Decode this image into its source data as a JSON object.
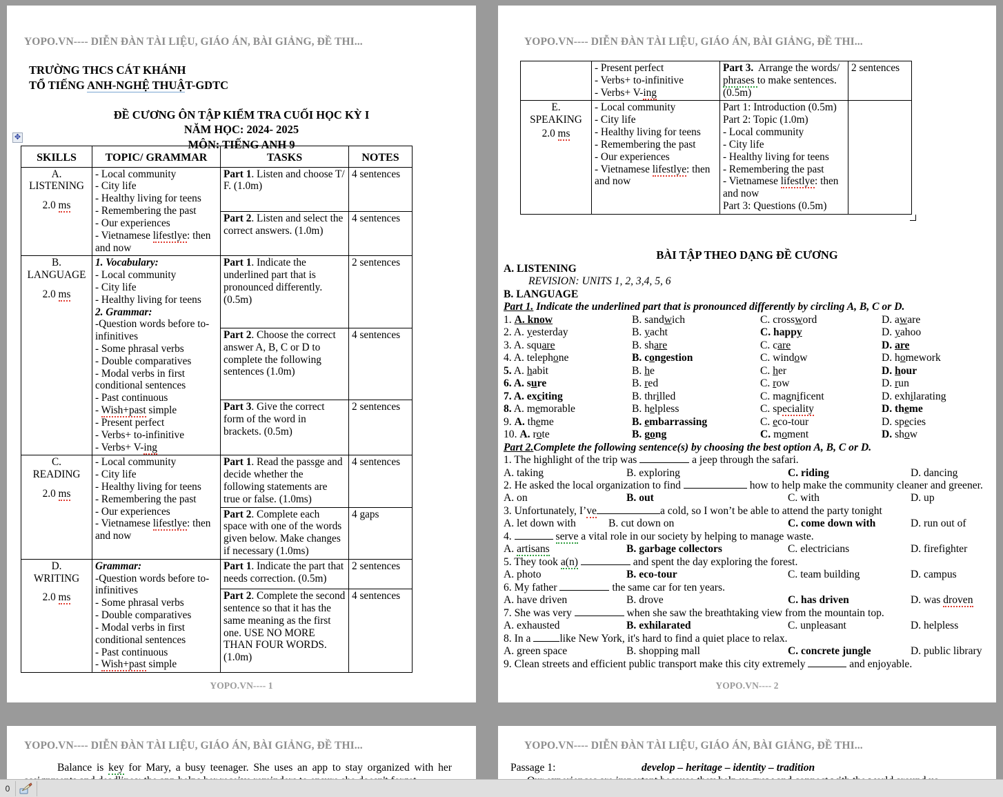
{
  "watermark": {
    "header": "YOPO.VN---- DIỄN ĐÀN TÀI LIỆU, GIÁO ÁN, BÀI GIẢNG, ĐỀ THI...",
    "footer_page1": "YOPO.VN---- 1",
    "footer_page2": "YOPO.VN---- 2"
  },
  "school": {
    "line1": "TRƯỜNG THCS CÁT KHÁNH",
    "line2_a": "TỔ TIẾNG ",
    "line2_b": "ANH-NGHỆ THUẬ",
    "line2_c": "T-GDTC"
  },
  "title": {
    "line1": "ĐỀ CƯƠNG ÔN TẬP KIỂM TRA CUỐI HỌC KỲ I",
    "line2": "NĂM HỌC: 2024- 2025",
    "line3": "MÔN: TIẾNG ANH 9"
  },
  "outline_table": {
    "headers": [
      "SKILLS",
      "TOPIC/ GRAMMAR",
      "TASKS",
      "NOTES"
    ],
    "listening": {
      "skill": "A.\nLISTENING",
      "skill_line1": "A.",
      "skill_line2": "LISTENING",
      "marks": "2.0 ms",
      "topics": [
        "- Local community",
        "- City life",
        "- Healthy living for teens",
        "- Remembering the past",
        "- Our experiences",
        "- Vietnamese lifestlye: then and now"
      ],
      "tasks": [
        {
          "label": "Part 1",
          "text": ". Listen and choose T/ F.  (1.0m)",
          "notes": "4 sentences"
        },
        {
          "label": "Part 2",
          "text": ". Listen and select the correct answers. (1.0m)",
          "notes": "4 sentences"
        }
      ]
    },
    "language": {
      "skill_line1": "B.",
      "skill_line2": "LANGUAGE",
      "marks": "2.0 ms",
      "vocab_heading": "1. Vocabulary:",
      "vocab_items": [
        "- Local community",
        "- City life",
        "- Healthy living for teens"
      ],
      "grammar_heading": "2. Grammar:",
      "grammar_items": [
        "-Question words before to-infinitives",
        "- Some phrasal verbs",
        "-  Double comparatives",
        "- Modal verbs in first conditional sentences",
        "- Past continuous",
        "- Wish+past simple",
        "- Present perfect",
        "- Verbs+ to-infinitive",
        "- Verbs+ V-ing"
      ],
      "tasks": [
        {
          "label": "Part 1",
          "text": ". Indicate the underlined part that is pronounced differently. (0.5m)",
          "notes": "2 sentences"
        },
        {
          "label": "Part 2",
          "text": ".  Choose the correct answer A, B, C or D to complete the following sentences (1.0m)",
          "notes": "4 sentences"
        },
        {
          "label": "Part 3",
          "text": ". Give the correct form of the word in brackets.  (0.5m)",
          "notes": "2 sentences"
        }
      ]
    },
    "reading": {
      "skill_line1": "C.",
      "skill_line2": "READING",
      "marks": "2.0 ms",
      "topics": [
        "- Local community",
        "- City life",
        "- Healthy living for teens",
        "- Remembering the past",
        "- Our experiences",
        "- Vietnamese lifestlye: then and now"
      ],
      "tasks": [
        {
          "label": "Part 1",
          "text": ". Read the passge and decide whether the following statements are true or false.  (1.0ms)",
          "notes": "4 sentences"
        },
        {
          "label": "Part 2",
          "text": ".  Complete each space with one of the words given below. Make changes if necessary (1.0ms)",
          "notes": "4 gaps"
        }
      ]
    },
    "writing": {
      "skill_line1": "D.",
      "skill_line2": "WRITING",
      "marks": "2.0 ms",
      "grammar_heading": "Grammar:",
      "grammar_items": [
        "-Question words before to-infinitives",
        "- Some phrasal verbs",
        "-  Double comparatives",
        "- Modal verbs in first conditional sentences",
        "- Past continuous",
        "- Wish+past simple"
      ],
      "tasks": [
        {
          "label": "Part 1",
          "text": ". Indicate the part that needs correction. (0.5m)",
          "notes": "2 sentences"
        },
        {
          "label": "Part 2",
          "text": ".  Complete the second sentence so that it has the same meaning as the first one. USE NO MORE THAN FOUR WORDS.  (1.0m)",
          "notes": "4 sentences"
        }
      ]
    },
    "continued": {
      "grammar_items": [
        "- Present perfect",
        "- Verbs+ to-infinitive",
        "- Verbs+ V-ing"
      ],
      "task_label": "Part 3.",
      "task_text": "  Arrange the words/ phrases  to make sentences. (0.5m)",
      "notes": "2 sentences"
    },
    "speaking": {
      "skill_line1": "E.",
      "skill_line2": "SPEAKING",
      "marks": "2.0 ms",
      "topics": [
        "- Local community",
        "- City life",
        "- Healthy living for teens",
        "- Remembering the past",
        "- Our experiences",
        "- Vietnamese lifestlye: then and now"
      ],
      "tasks": [
        "Part 1: Introduction (0.5m)",
        "Part 2: Topic (1.0m)",
        "- Local community",
        "- City life",
        "- Healthy living for teens",
        "- Remembering the past",
        "- Our experiences",
        "- Vietnamese lifestlye: then and now",
        "Part 3: Questions (0.5m)"
      ],
      "notes": ""
    }
  },
  "exercises": {
    "title": "BÀI TẬP THEO DẠNG ĐỀ CƯƠNG",
    "section_a": "A. LISTENING",
    "revision": "REVISION: UNITS 1, 2, 3,4, 5, 6",
    "section_b": "B. LANGUAGE",
    "part1_heading_a": "Part 1.",
    "part1_heading_b": " Indicate the underlined part that is pronounced differently by circling A, B, C or D.",
    "part1_items": [
      {
        "n": "1.",
        "n_bold": false,
        "a": "A. know",
        "a_bold": true,
        "b": "B. sandwich",
        "b_bold": false,
        "c": "C. crossword",
        "c_bold": false,
        "d": "D. aware",
        "d_bold": false
      },
      {
        "n": "2.",
        "n_bold": false,
        "a": "A. yesterday",
        "a_bold": false,
        "b": "B. yacht",
        "b_bold": false,
        "c": "C. happy",
        "c_bold": true,
        "d": "D. yahoo",
        "d_bold": false
      },
      {
        "n": "3.",
        "n_bold": false,
        "a": "A. square",
        "a_bold": false,
        "b": "B. share",
        "b_bold": false,
        "c": "C. care",
        "c_bold": false,
        "d": "D. are",
        "d_bold": true
      },
      {
        "n": "4.",
        "n_bold": false,
        "a": "A. telephone",
        "a_bold": false,
        "b": "B. congestion",
        "b_bold": true,
        "c": "C. window",
        "c_bold": false,
        "d": "D. homework",
        "d_bold": false
      },
      {
        "n": "5.",
        "n_bold": true,
        "a": "A. habit",
        "a_bold": false,
        "b": "B. he",
        "b_bold": false,
        "c": "C. her",
        "c_bold": false,
        "d": "D. hour",
        "d_bold": true
      },
      {
        "n": "6.",
        "n_bold": true,
        "a": "A. sure",
        "a_bold": true,
        "b": "B. red",
        "b_bold": false,
        "c": "C. row",
        "c_bold": false,
        "d": "D. run",
        "d_bold": false
      },
      {
        "n": "7.",
        "n_bold": true,
        "a": "A. exciting",
        "a_bold": true,
        "b": "B. thrilled",
        "b_bold": false,
        "c": "C. magnificent",
        "c_bold": false,
        "d": "D. exhilarating",
        "d_bold": false
      },
      {
        "n": "8.",
        "n_bold": true,
        "a": "A. memorable",
        "a_bold": false,
        "b": "B. helpless",
        "b_bold": false,
        "c": "C. speciality",
        "c_bold": false,
        "d": "D. theme",
        "d_bold": true
      },
      {
        "n": "9.",
        "n_bold": false,
        "a": "A. theme",
        "a_bold": true,
        "b": "B. embarrassing",
        "b_bold": true,
        "c": "C. eco-tour",
        "c_bold": false,
        "d": "D. species",
        "d_bold": false
      },
      {
        "n": "10.",
        "n_bold": false,
        "a": "A. rote",
        "a_bold": true,
        "b": "B. gong",
        "b_bold": true,
        "c": "C. moment",
        "c_bold": false,
        "d": "D. show",
        "d_bold": false
      }
    ],
    "part2_heading_a": "Part 2.",
    "part2_heading_b": "Complete the following sentence(s) by choosing the best option A, B, C or D.",
    "part2_items": [
      {
        "q_pre": "1. The highlight of the trip was ",
        "gap": "g8",
        "q_post": " a jeep through the safari.",
        "a": "A. taking",
        "a_bold": false,
        "b": "B. exploring",
        "b_bold": false,
        "c": "C. riding",
        "c_bold": true,
        "d": "D. dancing",
        "d_bold": false
      },
      {
        "q_pre": "2. He asked the local organization to find ",
        "gap": "g10",
        "q_post": " how to help make the community cleaner and greener.",
        "a": "A. on",
        "a_bold": false,
        "b": "B. out",
        "b_bold": true,
        "c": "C. with",
        "c_bold": false,
        "d": "D. up",
        "d_bold": false
      },
      {
        "q_pre": "3. Unfortunately, I’ve",
        "gap": "g10",
        "q_post": "a cold, so I won’t be able to attend the party tonight",
        "a": "A. let down with",
        "a_bold": false,
        "b": "B. cut down on",
        "b_bold": false,
        "c": "C. come down with",
        "c_bold": true,
        "d": "D. run out of",
        "d_bold": false
      },
      {
        "q_pre": "4. ",
        "gap": "g6",
        "q_post": " serve a vital role in our society by helping to manage waste.",
        "a": "A. artisans",
        "a_bold": false,
        "b": "B. garbage collectors",
        "b_bold": true,
        "c": "C. electricians",
        "c_bold": false,
        "d": "D. firefighter",
        "d_bold": false
      },
      {
        "q_pre": "5. They took a(n) ",
        "gap": "g8",
        "q_post": " and spent the day exploring the forest.",
        "a": "A. photo",
        "a_bold": false,
        "b": "B. eco-tour",
        "b_bold": true,
        "c": "C. team building",
        "c_bold": false,
        "d": "D. campus",
        "d_bold": false
      },
      {
        "q_pre": "6. My father ",
        "gap": "g8",
        "q_post": " the same car for ten years.",
        "a": "A. have driven",
        "a_bold": false,
        "b": "B. drove",
        "b_bold": false,
        "c": "C. has driven",
        "c_bold": true,
        "d": "D. was droven",
        "d_bold": false
      },
      {
        "q_pre": "7. She was very ",
        "gap": "g8",
        "q_post": " when she saw the breathtaking view from the mountain top.",
        "a": "A. exhausted",
        "a_bold": false,
        "b": "B. exhilarated",
        "b_bold": true,
        "c": "C. unpleasant",
        "c_bold": false,
        "d": "D. helpless",
        "d_bold": false
      },
      {
        "q_pre": "8. In a ",
        "gap": "g4",
        "q_post": "like New York, it's hard to find a quiet place to relax.",
        "a": "A. green space",
        "a_bold": false,
        "b": "B. shopping mall",
        "b_bold": false,
        "c": "C. concrete jungle",
        "c_bold": true,
        "d": "D. public library",
        "d_bold": false
      }
    ],
    "part2_last": {
      "q_pre": "9. Clean streets and efficient public transport make this city extremely ",
      "gap": "g6",
      "q_post": " and enjoyable."
    }
  },
  "bottom_strip": {
    "left_text": "Balance is key for Mary, a busy teenager. She uses an app to stay organized with her",
    "left_text2": "assignments and deadlines; the app helps her receive reminders to ensure she doesn't forget",
    "right_label": "Passage 1:",
    "right_words": "develop – heritage – identity – tradition",
    "right_text2": "Our experiences are important because they help us grow and connect with the world around us."
  },
  "statusbar": {
    "page_number": "0",
    "icon": "format-painter-icon"
  }
}
